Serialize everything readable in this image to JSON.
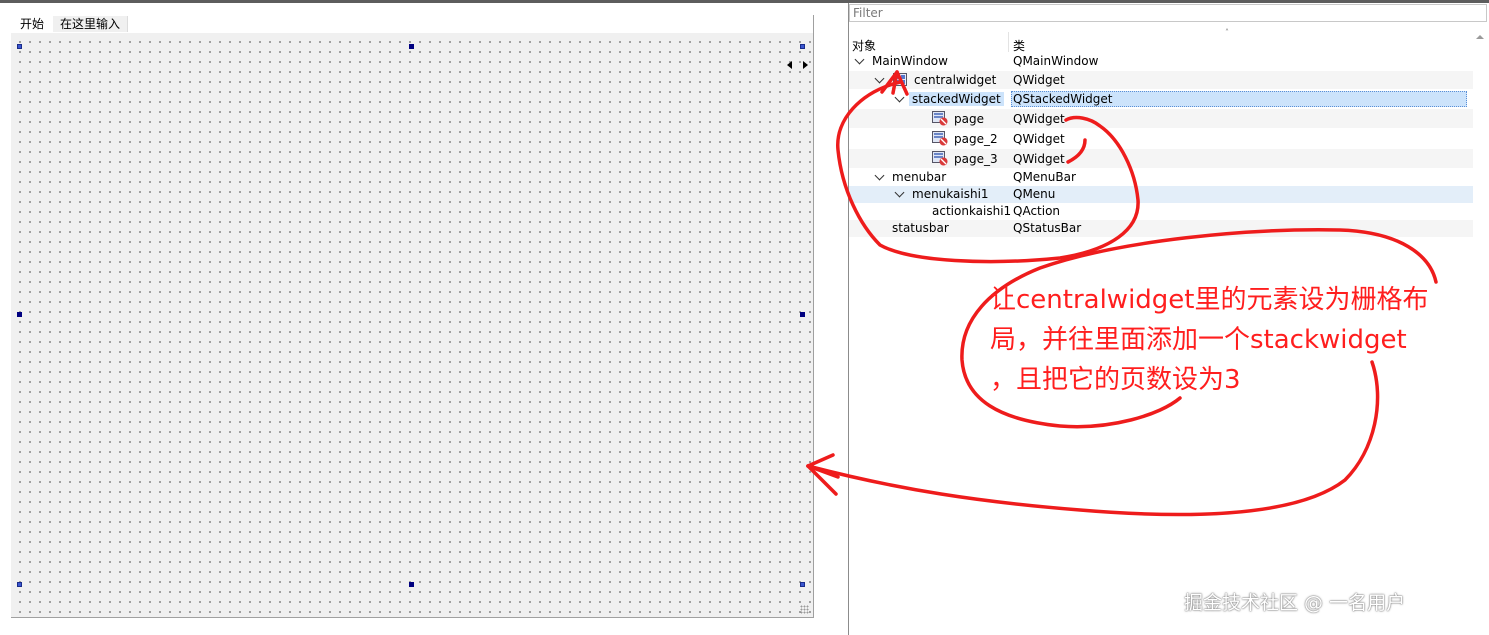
{
  "menu": {
    "items": [
      "开始",
      "在这里输入"
    ]
  },
  "inspector": {
    "filter_placeholder": "Filter",
    "columns": {
      "object": "对象",
      "class": "类"
    },
    "rows": [
      {
        "name": "MainWindow",
        "cls": "QMainWindow",
        "depth": 0,
        "expanded": true,
        "icon": "none"
      },
      {
        "name": "centralwidget",
        "cls": "QWidget",
        "depth": 1,
        "expanded": true,
        "icon": "grid-layout-icon"
      },
      {
        "name": "stackedWidget",
        "cls": "QStackedWidget",
        "depth": 2,
        "expanded": true,
        "icon": "none",
        "selected": true
      },
      {
        "name": "page",
        "cls": "QWidget",
        "depth": 3,
        "expanded": false,
        "icon": "no-layout-icon"
      },
      {
        "name": "page_2",
        "cls": "QWidget",
        "depth": 3,
        "expanded": false,
        "icon": "no-layout-icon"
      },
      {
        "name": "page_3",
        "cls": "QWidget",
        "depth": 3,
        "expanded": false,
        "icon": "no-layout-icon"
      },
      {
        "name": "menubar",
        "cls": "QMenuBar",
        "depth": 1,
        "expanded": true,
        "icon": "none"
      },
      {
        "name": "menukaishi1",
        "cls": "QMenu",
        "depth": 2,
        "expanded": true,
        "icon": "none"
      },
      {
        "name": "actionkaishi1",
        "cls": "QAction",
        "depth": 3,
        "expanded": false,
        "icon": "none"
      },
      {
        "name": "statusbar",
        "cls": "QStatusBar",
        "depth": 1,
        "expanded": false,
        "icon": "none"
      }
    ]
  },
  "annotation": {
    "lines": [
      "让centralwidget里的元素设为栅格布",
      "局，并往里面添加一个stackwidget",
      "，且把它的页数设为3"
    ]
  },
  "watermark": "掘金技术社区 @ 一名用户",
  "colors": {
    "annotation": "#ff1e1e",
    "selection": "#cce3fb",
    "handle": "#000080"
  }
}
